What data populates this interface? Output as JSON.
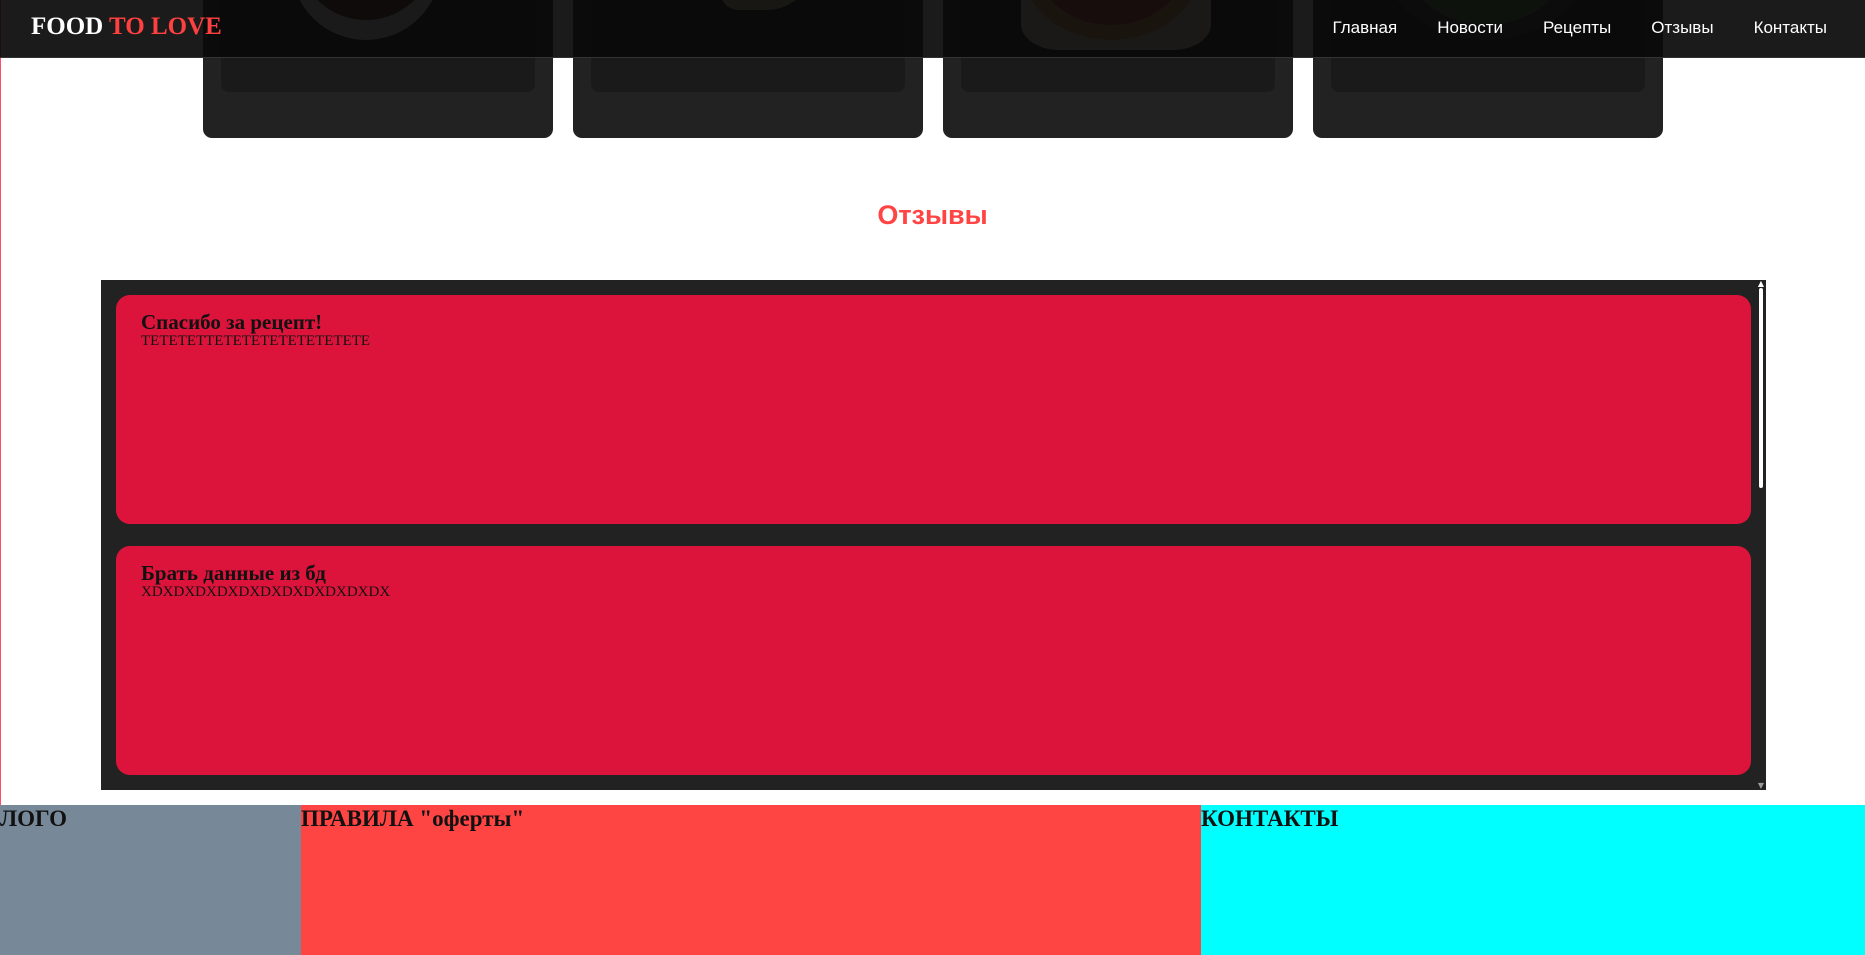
{
  "brand": {
    "name_part1": "FOOD",
    "name_part2": "TO LOVE"
  },
  "nav": {
    "items": [
      "Главная",
      "Новости",
      "Рецепты",
      "Отзывы",
      "Контакты"
    ]
  },
  "reviews_section": {
    "title": "Отзывы",
    "items": [
      {
        "title": "Спасибо за рецепт!",
        "text": "ТЕТЕТЕТТЕТЕТЕТЕТЕТЕТЕТЕТЕ"
      },
      {
        "title": "Брать данные из бд",
        "text": "XDXDXDXDXDXDXDXDXDXDXDX"
      }
    ]
  },
  "footer": {
    "logo": "ЛОГО",
    "rules": "ПРАВИЛА \"оферты\"",
    "contacts": "КОНТАКТЫ"
  },
  "colors": {
    "brand_accent": "#ff4040",
    "review_card": "#dc143c",
    "footer_logo": "#778899",
    "footer_rules": "#ff4444",
    "footer_contacts": "#00ffff"
  }
}
